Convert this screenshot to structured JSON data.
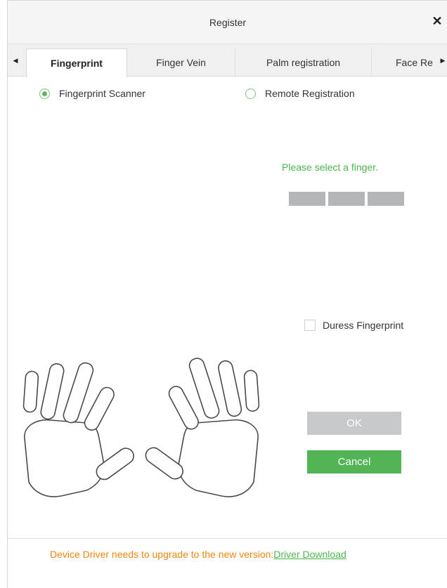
{
  "dialog": {
    "title": "Register",
    "close_symbol": "✕"
  },
  "tabs": [
    {
      "label": "Fingerprint",
      "active": true
    },
    {
      "label": "Finger Vein",
      "active": false
    },
    {
      "label": "Palm registration",
      "active": false
    },
    {
      "label": "Face Re",
      "active": false
    }
  ],
  "tab_nav": {
    "left_icon": "caret-left-icon",
    "right_icon": "caret-right-icon"
  },
  "mode": {
    "options": [
      {
        "label": "Fingerprint Scanner",
        "selected": true
      },
      {
        "label": "Remote Registration",
        "selected": false
      }
    ]
  },
  "status": {
    "hint": "Please select a finger.",
    "segments": 3
  },
  "duress": {
    "label": "Duress Fingerprint",
    "checked": false
  },
  "buttons": {
    "ok_label": "OK",
    "cancel_label": "Cancel"
  },
  "footer": {
    "message": "Device Driver needs to upgrade to the new version:",
    "link": "Driver Download"
  },
  "colors": {
    "accent_green": "#52b455",
    "hint_green": "#4cb84c",
    "warning_orange": "#f0860f",
    "disabled_gray": "#c7c9cb"
  }
}
